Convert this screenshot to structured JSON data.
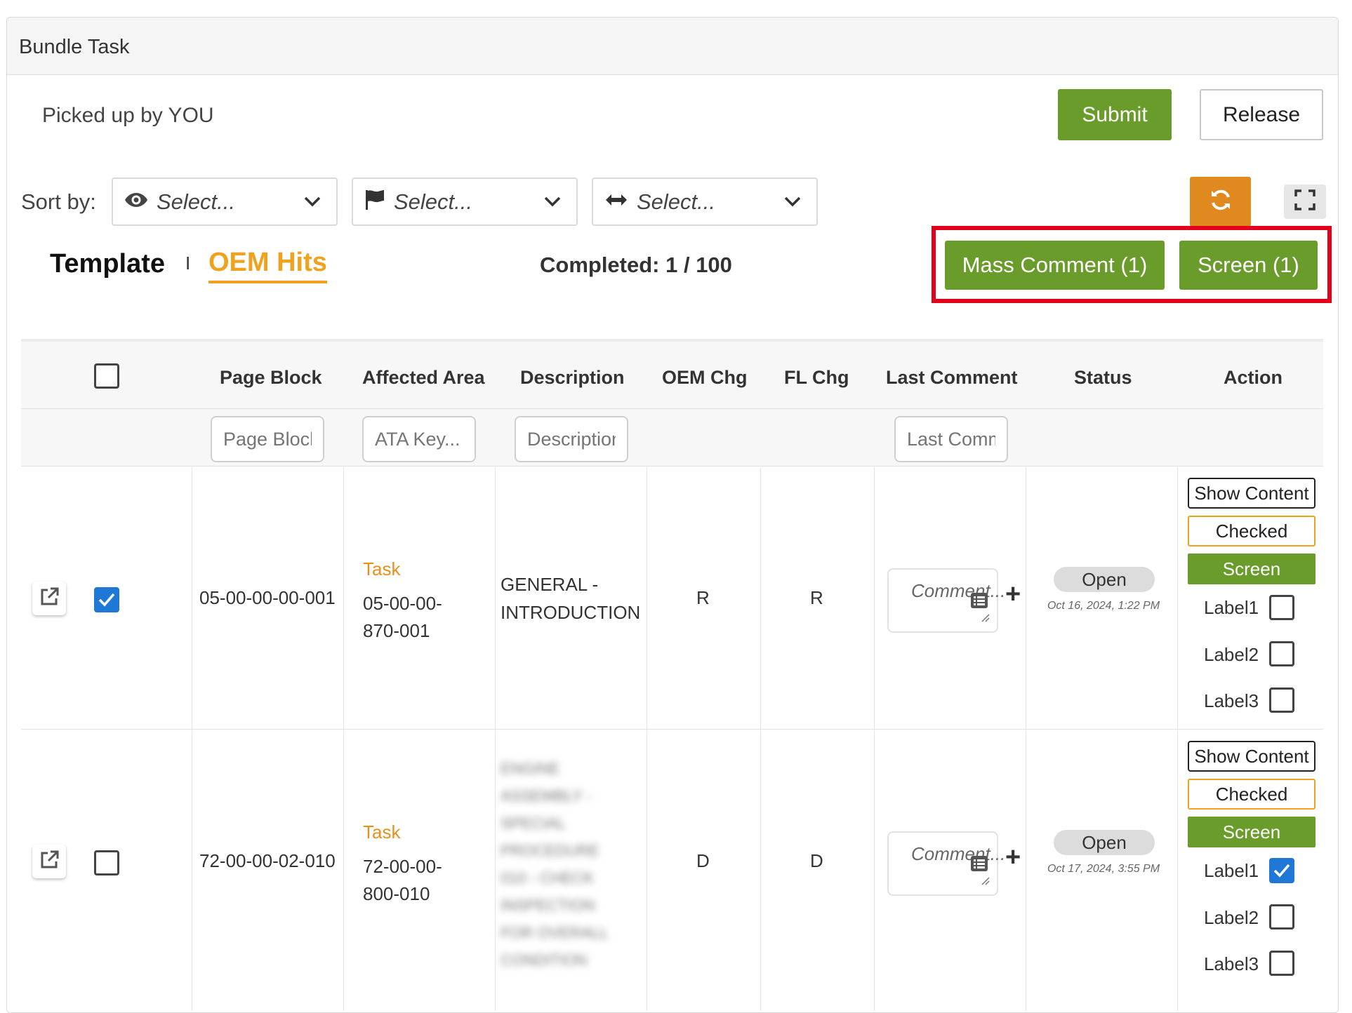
{
  "panel": {
    "title": "Bundle Task"
  },
  "header": {
    "picked_up": "Picked up by YOU",
    "submit_label": "Submit",
    "release_label": "Release"
  },
  "sort": {
    "label": "Sort by:",
    "selects": [
      {
        "icon": "eye-icon",
        "placeholder": "Select..."
      },
      {
        "icon": "flag-icon",
        "placeholder": "Select..."
      },
      {
        "icon": "horizontal-arrows-icon",
        "placeholder": "Select..."
      }
    ]
  },
  "toolbar": {
    "refresh_icon": "refresh-icon",
    "fullscreen_icon": "fullscreen-icon",
    "mass_comment_label": "Mass Comment (1)",
    "screen_label": "Screen (1)"
  },
  "tabs": {
    "template": "Template",
    "separator": "I",
    "oem_hits": "OEM Hits",
    "completed": "Completed: 1 / 100"
  },
  "colors": {
    "green": "#6a9c2b",
    "orange": "#e0891e",
    "tab_active": "#f0a11d",
    "highlight": "#e3001b",
    "checkbox_blue": "#1f78d6"
  },
  "table": {
    "columns": [
      "Page Block",
      "Affected Area",
      "Description",
      "OEM Chg",
      "FL Chg",
      "Last Comment",
      "Status",
      "Action"
    ],
    "filters": {
      "page_block": "Page Block",
      "ata_key": "ATA Key...",
      "description": "Description",
      "last_comment": "Last Comment"
    },
    "rows": [
      {
        "checked": true,
        "page_block": "05-00-00-00-001",
        "task_label": "Task",
        "ata_line1": "05-00-00-",
        "ata_line2": "870-001",
        "desc_line1": "GENERAL -",
        "desc_line2": "INTRODUCTION",
        "oem_chg": "R",
        "fl_chg": "R",
        "comment_placeholder": "Comment...",
        "status": "Open",
        "status_date": "Oct 16, 2024, 1:22 PM",
        "actions": {
          "show": "Show Content",
          "checked": "Checked",
          "screen": "Screen"
        },
        "labels": [
          {
            "name": "Label1",
            "checked": false
          },
          {
            "name": "Label2",
            "checked": false
          },
          {
            "name": "Label3",
            "checked": false
          }
        ]
      },
      {
        "checked": false,
        "page_block": "72-00-00-02-010",
        "task_label": "Task",
        "ata_line1": "72-00-00-",
        "ata_line2": "800-010",
        "desc_blurred": "ENGINE ASSEMBLY - SPECIAL PROCEDURE 010 - CHECK INSPECTION FOR OVERALL CONDITION",
        "oem_chg": "D",
        "fl_chg": "D",
        "comment_placeholder": "Comment...",
        "status": "Open",
        "status_date": "Oct 17, 2024, 3:55 PM",
        "actions": {
          "show": "Show Content",
          "checked": "Checked",
          "screen": "Screen"
        },
        "labels": [
          {
            "name": "Label1",
            "checked": true
          },
          {
            "name": "Label2",
            "checked": false
          },
          {
            "name": "Label3",
            "checked": false
          }
        ]
      }
    ]
  }
}
